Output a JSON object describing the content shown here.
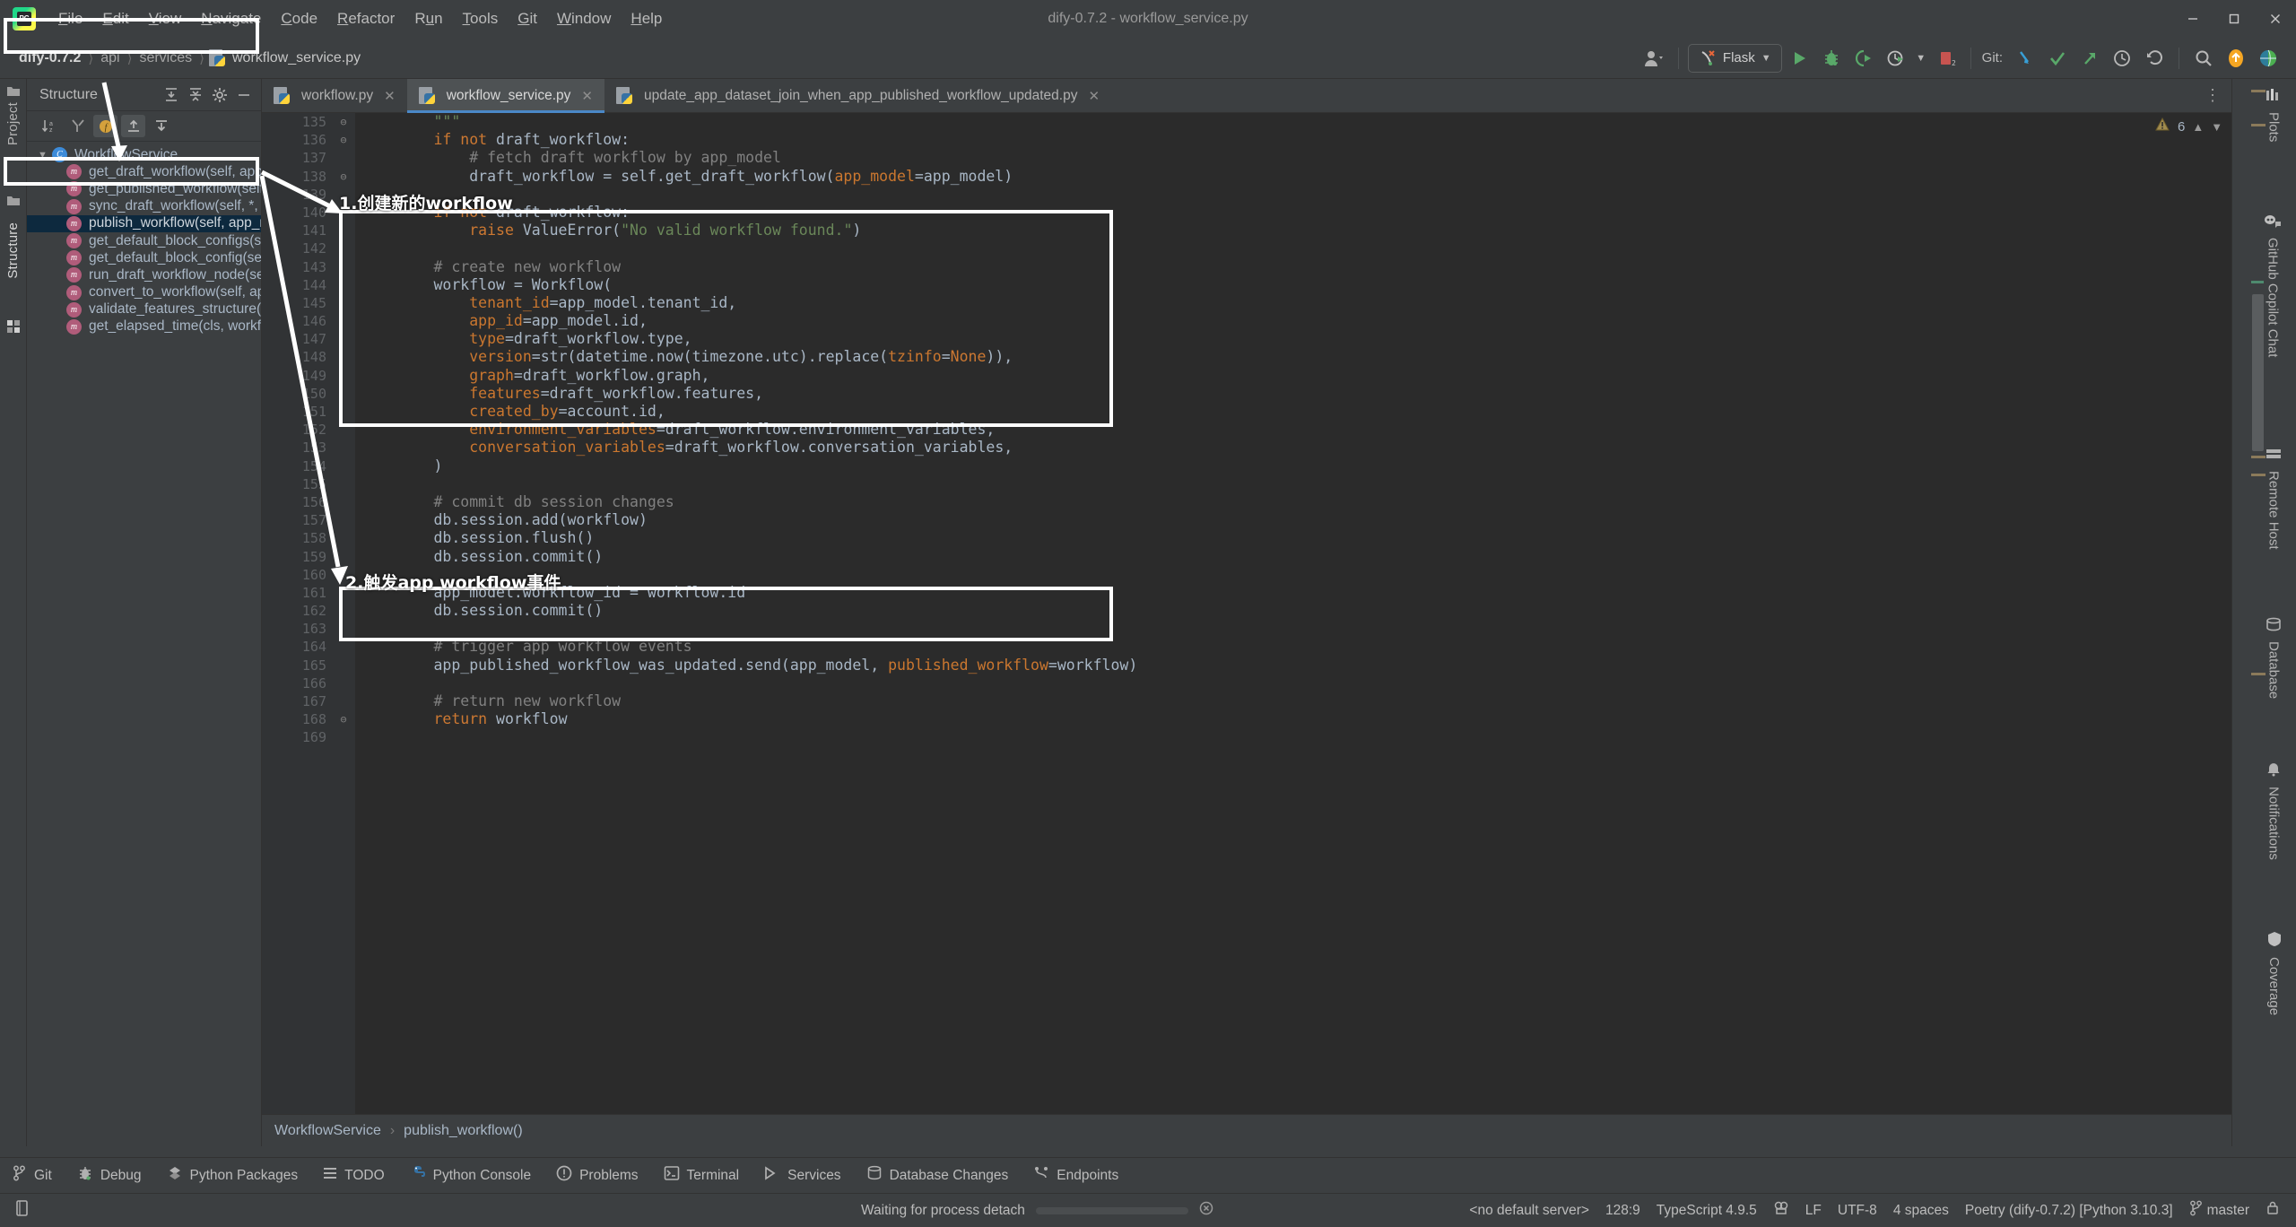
{
  "window": {
    "title": "dify-0.7.2 - workflow_service.py",
    "minimize": "–",
    "maximize": "❐",
    "close": "✕"
  },
  "menu": {
    "items": [
      {
        "label": "File",
        "mnemonic": "F"
      },
      {
        "label": "Edit",
        "mnemonic": "E"
      },
      {
        "label": "View",
        "mnemonic": "V"
      },
      {
        "label": "Navigate",
        "mnemonic": "N"
      },
      {
        "label": "Code",
        "mnemonic": "C"
      },
      {
        "label": "Refactor",
        "mnemonic": "R"
      },
      {
        "label": "Run",
        "mnemonic": "u"
      },
      {
        "label": "Tools",
        "mnemonic": "T"
      },
      {
        "label": "Git",
        "mnemonic": "G"
      },
      {
        "label": "Window",
        "mnemonic": "W"
      },
      {
        "label": "Help",
        "mnemonic": "H"
      }
    ]
  },
  "breadcrumb_top": {
    "root": "dify-0.7.2",
    "parts": [
      "api",
      "services"
    ],
    "file": "workflow_service.py"
  },
  "toolbar": {
    "run_config": "Flask",
    "git_label": "Git:",
    "icons": [
      "user-avatar-icon",
      "run-icon",
      "debug-icon",
      "run-coverage-icon",
      "profile-icon",
      "stop-icon",
      "git-update-icon",
      "git-commit-icon",
      "git-push-icon",
      "git-history-icon",
      "git-rollback-icon",
      "search-everywhere-icon",
      "ai-assistant-icon",
      "settings-globe-icon"
    ]
  },
  "left_strip": {
    "tabs": [
      "Project",
      "Structure"
    ]
  },
  "structure": {
    "title": "Structure",
    "header_buttons": [
      "expand-all-icon",
      "collapse-all-icon",
      "settings-icon",
      "hide-icon"
    ],
    "tool_buttons": [
      "sort-alphabetically-icon",
      "sort-by-visibility-icon",
      "show-fields-icon",
      "show-inherited-icon",
      "show-anonymous-icon"
    ],
    "root": "WorkflowService",
    "methods": [
      "get_draft_workflow(self, app_model)",
      "get_published_workflow(self, app_model",
      "sync_draft_workflow(self, *, app_model, c",
      "publish_workflow(self, app_model, accou",
      "get_default_block_configs(self)",
      "get_default_block_config(self, node_type",
      "run_draft_workflow_node(self, app_mode",
      "convert_to_workflow(self, app_model, ac",
      "validate_features_structure(self, app_mo",
      "get_elapsed_time(cls, workflow_run_id)"
    ],
    "selected_index": 3
  },
  "editor": {
    "tabs": [
      {
        "label": "workflow.py",
        "active": false
      },
      {
        "label": "workflow_service.py",
        "active": true
      },
      {
        "label": "update_app_dataset_join_when_app_published_workflow_updated.py",
        "active": false
      }
    ],
    "warning_count": "6",
    "warning_icon": "warning-triangle-icon",
    "breadcrumb": {
      "class": "WorkflowService",
      "method": "publish_workflow()"
    }
  },
  "code": {
    "first_line": 135,
    "lines": [
      {
        "n": 135,
        "fold": "⊖",
        "tokens": [
          {
            "t": "        ",
            "c": ""
          },
          {
            "t": "\"\"\"",
            "c": "str"
          }
        ]
      },
      {
        "n": 136,
        "fold": "⊖",
        "tokens": [
          {
            "t": "        ",
            "c": ""
          },
          {
            "t": "if not",
            "c": "kw"
          },
          {
            "t": " draft_workflow:",
            "c": ""
          }
        ]
      },
      {
        "n": 137,
        "fold": "",
        "tokens": [
          {
            "t": "            ",
            "c": ""
          },
          {
            "t": "# fetch draft workflow by app_model",
            "c": "cmt"
          }
        ]
      },
      {
        "n": 138,
        "fold": "⊖",
        "tokens": [
          {
            "t": "            draft_workflow = ",
            "c": ""
          },
          {
            "t": "self",
            "c": ""
          },
          {
            "t": ".get_draft_workflow(",
            "c": ""
          },
          {
            "t": "app_model",
            "c": "param"
          },
          {
            "t": "=app_model)",
            "c": ""
          }
        ]
      },
      {
        "n": 139,
        "fold": "",
        "tokens": []
      },
      {
        "n": 140,
        "fold": "",
        "tokens": [
          {
            "t": "        ",
            "c": ""
          },
          {
            "t": "if not",
            "c": "kw"
          },
          {
            "t": " draft_workflow:",
            "c": ""
          }
        ]
      },
      {
        "n": 141,
        "fold": "",
        "tokens": [
          {
            "t": "            ",
            "c": ""
          },
          {
            "t": "raise",
            "c": "kw"
          },
          {
            "t": " ValueError(",
            "c": ""
          },
          {
            "t": "\"No valid workflow found.\"",
            "c": "str"
          },
          {
            "t": ")",
            "c": ""
          }
        ]
      },
      {
        "n": 142,
        "fold": "",
        "tokens": []
      },
      {
        "n": 143,
        "fold": "",
        "tokens": [
          {
            "t": "        ",
            "c": ""
          },
          {
            "t": "# create new workflow",
            "c": "cmt"
          }
        ]
      },
      {
        "n": 144,
        "fold": "",
        "tokens": [
          {
            "t": "        workflow = Workflow(",
            "c": ""
          }
        ]
      },
      {
        "n": 145,
        "fold": "",
        "tokens": [
          {
            "t": "            ",
            "c": ""
          },
          {
            "t": "tenant_id",
            "c": "param"
          },
          {
            "t": "=app_model.tenant_id,",
            "c": ""
          }
        ]
      },
      {
        "n": 146,
        "fold": "",
        "tokens": [
          {
            "t": "            ",
            "c": ""
          },
          {
            "t": "app_id",
            "c": "param"
          },
          {
            "t": "=app_model.id,",
            "c": ""
          }
        ]
      },
      {
        "n": 147,
        "fold": "",
        "tokens": [
          {
            "t": "            ",
            "c": ""
          },
          {
            "t": "type",
            "c": "param"
          },
          {
            "t": "=draft_workflow.type,",
            "c": ""
          }
        ]
      },
      {
        "n": 148,
        "fold": "",
        "tokens": [
          {
            "t": "            ",
            "c": ""
          },
          {
            "t": "version",
            "c": "param"
          },
          {
            "t": "=str(datetime.now(timezone.utc).replace(",
            "c": ""
          },
          {
            "t": "tzinfo",
            "c": "param"
          },
          {
            "t": "=",
            "c": ""
          },
          {
            "t": "None",
            "c": "kw"
          },
          {
            "t": ")),",
            "c": ""
          }
        ]
      },
      {
        "n": 149,
        "fold": "",
        "tokens": [
          {
            "t": "            ",
            "c": ""
          },
          {
            "t": "graph",
            "c": "param"
          },
          {
            "t": "=draft_workflow.graph,",
            "c": ""
          }
        ]
      },
      {
        "n": 150,
        "fold": "",
        "tokens": [
          {
            "t": "            ",
            "c": ""
          },
          {
            "t": "features",
            "c": "param"
          },
          {
            "t": "=draft_workflow.features,",
            "c": ""
          }
        ]
      },
      {
        "n": 151,
        "fold": "",
        "tokens": [
          {
            "t": "            ",
            "c": ""
          },
          {
            "t": "created_by",
            "c": "param"
          },
          {
            "t": "=account.id,",
            "c": ""
          }
        ]
      },
      {
        "n": 152,
        "fold": "",
        "tokens": [
          {
            "t": "            ",
            "c": ""
          },
          {
            "t": "environment_variables",
            "c": "param"
          },
          {
            "t": "=draft_workflow.environment_variables,",
            "c": ""
          }
        ]
      },
      {
        "n": 153,
        "fold": "",
        "tokens": [
          {
            "t": "            ",
            "c": ""
          },
          {
            "t": "conversation_variables",
            "c": "param"
          },
          {
            "t": "=draft_workflow.conversation_variables,",
            "c": ""
          }
        ]
      },
      {
        "n": 154,
        "fold": "",
        "tokens": [
          {
            "t": "        )",
            "c": ""
          }
        ]
      },
      {
        "n": 155,
        "fold": "",
        "tokens": []
      },
      {
        "n": 156,
        "fold": "",
        "tokens": [
          {
            "t": "        ",
            "c": ""
          },
          {
            "t": "# commit db session changes",
            "c": "cmt"
          }
        ]
      },
      {
        "n": 157,
        "fold": "",
        "tokens": [
          {
            "t": "        db.session.add(workflow)",
            "c": ""
          }
        ]
      },
      {
        "n": 158,
        "fold": "",
        "tokens": [
          {
            "t": "        db.session.flush()",
            "c": ""
          }
        ]
      },
      {
        "n": 159,
        "fold": "",
        "tokens": [
          {
            "t": "        db.session.commit()",
            "c": ""
          }
        ]
      },
      {
        "n": 160,
        "fold": "",
        "tokens": []
      },
      {
        "n": 161,
        "fold": "",
        "tokens": [
          {
            "t": "        app_model.workflow_id = workflow.id",
            "c": ""
          }
        ]
      },
      {
        "n": 162,
        "fold": "",
        "tokens": [
          {
            "t": "        db.session.commit()",
            "c": ""
          }
        ]
      },
      {
        "n": 163,
        "fold": "",
        "tokens": []
      },
      {
        "n": 164,
        "fold": "",
        "tokens": [
          {
            "t": "        ",
            "c": ""
          },
          {
            "t": "# trigger app workflow events",
            "c": "cmt"
          }
        ]
      },
      {
        "n": 165,
        "fold": "",
        "tokens": [
          {
            "t": "        app_published_workflow_was_updated.send(app_model, ",
            "c": ""
          },
          {
            "t": "published_workflow",
            "c": "param"
          },
          {
            "t": "=workflow)",
            "c": ""
          }
        ]
      },
      {
        "n": 166,
        "fold": "",
        "tokens": []
      },
      {
        "n": 167,
        "fold": "",
        "tokens": [
          {
            "t": "        ",
            "c": ""
          },
          {
            "t": "# return new workflow",
            "c": "cmt"
          }
        ]
      },
      {
        "n": 168,
        "fold": "⊖",
        "tokens": [
          {
            "t": "        ",
            "c": ""
          },
          {
            "t": "return",
            "c": "kw"
          },
          {
            "t": " workflow",
            "c": ""
          }
        ]
      },
      {
        "n": 169,
        "fold": "",
        "tokens": []
      }
    ]
  },
  "annotations": [
    {
      "id": "ann-1",
      "text": "1.创建新的workflow"
    },
    {
      "id": "ann-2",
      "text": "2.触发app workflow事件"
    }
  ],
  "right_strip": {
    "items": [
      "Plots",
      "GitHub Copilot Chat",
      "Remote Host",
      "Database",
      "Notifications",
      "Coverage"
    ]
  },
  "bottom_tools": [
    {
      "label": "Git",
      "icon": "git-branch-icon"
    },
    {
      "label": "Debug",
      "icon": "debug-bug-icon"
    },
    {
      "label": "Python Packages",
      "icon": "packages-icon"
    },
    {
      "label": "TODO",
      "icon": "todo-list-icon"
    },
    {
      "label": "Python Console",
      "icon": "python-console-icon"
    },
    {
      "label": "Problems",
      "icon": "problems-icon"
    },
    {
      "label": "Terminal",
      "icon": "terminal-icon"
    },
    {
      "label": "Services",
      "icon": "services-icon"
    },
    {
      "label": "Database Changes",
      "icon": "database-changes-icon"
    },
    {
      "label": "Endpoints",
      "icon": "endpoints-icon"
    }
  ],
  "statusbar": {
    "process_text": "Waiting for process detach",
    "server": "<no default server>",
    "caret": "128:9",
    "language": "TypeScript 4.9.5",
    "line_sep": "LF",
    "encoding": "UTF-8",
    "indent": "4 spaces",
    "interpreter": "Poetry (dify-0.7.2) [Python 3.10.3]",
    "branch": "master",
    "lock_icon": "lock-icon",
    "memory_icon": "memory-indicator-icon"
  },
  "colors": {
    "bg_chrome": "#3c3f41",
    "bg_editor": "#2b2b2b",
    "gutter": "#313335",
    "accent_blue": "#4a88c7",
    "selection": "#0d293e",
    "text": "#a9b7c6",
    "comment": "#808080",
    "keyword": "#cc7832",
    "string": "#6a8759",
    "param": "#cb772f",
    "annotation": "#ffffff"
  }
}
